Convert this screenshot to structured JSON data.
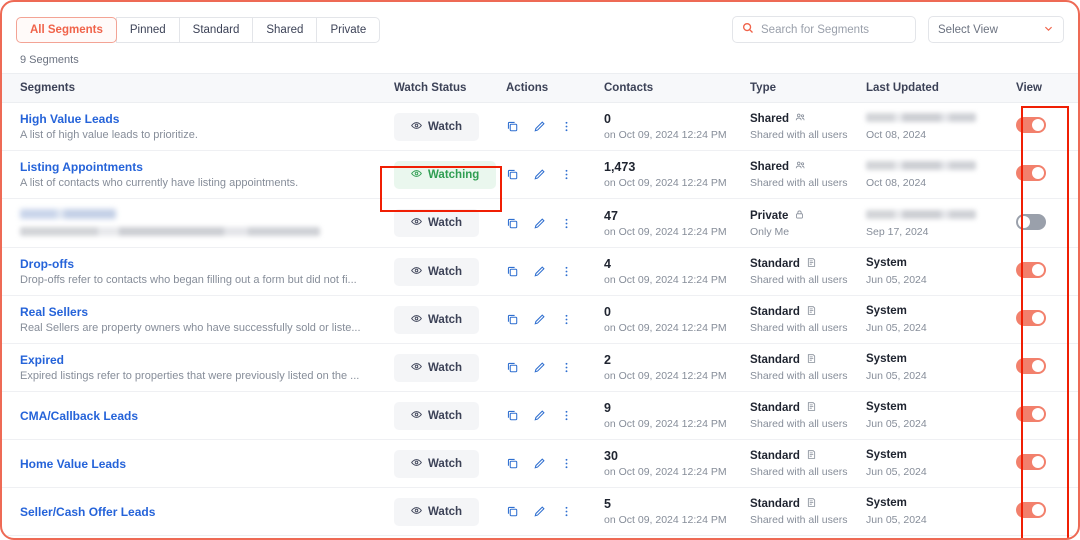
{
  "filters": {
    "tabs": [
      {
        "label": "All Segments",
        "active": true
      },
      {
        "label": "Pinned",
        "active": false
      },
      {
        "label": "Standard",
        "active": false
      },
      {
        "label": "Shared",
        "active": false
      },
      {
        "label": "Private",
        "active": false
      }
    ]
  },
  "search": {
    "placeholder": "Search for Segments",
    "value": ""
  },
  "select_view": {
    "label": "Select View"
  },
  "summary": {
    "count_label": "9 Segments"
  },
  "columns": {
    "segments": "Segments",
    "watch_status": "Watch Status",
    "actions": "Actions",
    "contacts": "Contacts",
    "type": "Type",
    "last_updated": "Last Updated",
    "view": "View"
  },
  "labels": {
    "watch": "Watch",
    "watching": "Watching",
    "shared": "Shared",
    "shared_sub": "Shared with all users",
    "private": "Private",
    "private_sub": "Only Me",
    "standard": "Standard",
    "system": "System"
  },
  "colors": {
    "accent": "#f0634a",
    "link": "#2563d9",
    "watching_text": "#2f9e52",
    "watching_bg": "#eaf7ee",
    "toggle_on": "#f2806c",
    "toggle_off": "#9aa0ab",
    "annotation": "#f01f04",
    "icon_blue": "#2f6fd0"
  },
  "rows": [
    {
      "name": "High Value Leads",
      "desc": "A list of high value leads to prioritize.",
      "redacted_name": false,
      "watch_state": "watch",
      "contacts": "0",
      "contacts_sub": "on Oct 09, 2024 12:24 PM",
      "type": "Shared",
      "type_sub": "Shared with all users",
      "type_icon": "people-icon",
      "updated_by": "",
      "updated_redacted": true,
      "updated_date": "Oct 08, 2024",
      "view_on": true
    },
    {
      "name": "Listing Appointments",
      "desc": "A list of contacts who currently have listing appointments.",
      "redacted_name": false,
      "watch_state": "watching",
      "contacts": "1,473",
      "contacts_sub": "on Oct 09, 2024 12:24 PM",
      "type": "Shared",
      "type_sub": "Shared with all users",
      "type_icon": "people-icon",
      "updated_by": "",
      "updated_redacted": true,
      "updated_date": "Oct 08, 2024",
      "view_on": true
    },
    {
      "name": "",
      "desc": "",
      "redacted_name": true,
      "watch_state": "watch",
      "contacts": "47",
      "contacts_sub": "on Oct 09, 2024 12:24 PM",
      "type": "Private",
      "type_sub": "Only Me",
      "type_icon": "lock-icon",
      "updated_by": "",
      "updated_redacted": true,
      "updated_date": "Sep 17, 2024",
      "view_on": false
    },
    {
      "name": "Drop-offs",
      "desc": "Drop-offs refer to contacts who began filling out a form but did not fi...",
      "redacted_name": false,
      "watch_state": "watch",
      "contacts": "4",
      "contacts_sub": "on Oct 09, 2024 12:24 PM",
      "type": "Standard",
      "type_sub": "Shared with all users",
      "type_icon": "doc-icon",
      "updated_by": "System",
      "updated_redacted": false,
      "updated_date": "Jun 05, 2024",
      "view_on": true
    },
    {
      "name": "Real Sellers",
      "desc": "Real Sellers are property owners who have successfully sold or liste...",
      "redacted_name": false,
      "watch_state": "watch",
      "contacts": "0",
      "contacts_sub": "on Oct 09, 2024 12:24 PM",
      "type": "Standard",
      "type_sub": "Shared with all users",
      "type_icon": "doc-icon",
      "updated_by": "System",
      "updated_redacted": false,
      "updated_date": "Jun 05, 2024",
      "view_on": true
    },
    {
      "name": "Expired",
      "desc": "Expired listings refer to properties that were previously listed on the ...",
      "redacted_name": false,
      "watch_state": "watch",
      "contacts": "2",
      "contacts_sub": "on Oct 09, 2024 12:24 PM",
      "type": "Standard",
      "type_sub": "Shared with all users",
      "type_icon": "doc-icon",
      "updated_by": "System",
      "updated_redacted": false,
      "updated_date": "Jun 05, 2024",
      "view_on": true
    },
    {
      "name": "CMA/Callback Leads",
      "desc": "",
      "redacted_name": false,
      "watch_state": "watch",
      "contacts": "9",
      "contacts_sub": "on Oct 09, 2024 12:24 PM",
      "type": "Standard",
      "type_sub": "Shared with all users",
      "type_icon": "doc-icon",
      "updated_by": "System",
      "updated_redacted": false,
      "updated_date": "Jun 05, 2024",
      "view_on": true
    },
    {
      "name": "Home Value Leads",
      "desc": "",
      "redacted_name": false,
      "watch_state": "watch",
      "contacts": "30",
      "contacts_sub": "on Oct 09, 2024 12:24 PM",
      "type": "Standard",
      "type_sub": "Shared with all users",
      "type_icon": "doc-icon",
      "updated_by": "System",
      "updated_redacted": false,
      "updated_date": "Jun 05, 2024",
      "view_on": true
    },
    {
      "name": "Seller/Cash Offer Leads",
      "desc": "",
      "redacted_name": false,
      "watch_state": "watch",
      "contacts": "5",
      "contacts_sub": "on Oct 09, 2024 12:24 PM",
      "type": "Standard",
      "type_sub": "Shared with all users",
      "type_icon": "doc-icon",
      "updated_by": "System",
      "updated_redacted": false,
      "updated_date": "Jun 05, 2024",
      "view_on": true
    }
  ]
}
